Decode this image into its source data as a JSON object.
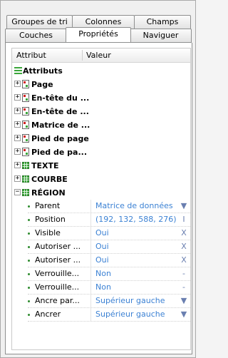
{
  "tabs_row1": [
    {
      "label": "Groupes de tri"
    },
    {
      "label": "Colonnes"
    },
    {
      "label": "Champs"
    }
  ],
  "tabs_row2": [
    {
      "label": "Couches"
    },
    {
      "label": "Propriétés"
    },
    {
      "label": "Naviguer"
    }
  ],
  "tree": {
    "col_attribut": "Attribut",
    "col_valeur": "Valeur",
    "root_label": "Attributs",
    "nodes": [
      {
        "label": "Page",
        "expander": "+"
      },
      {
        "label": "En-tête du ...",
        "expander": "+"
      },
      {
        "label": "En-tête de ...",
        "expander": "+"
      },
      {
        "label": "Matrice de ...",
        "expander": "+"
      },
      {
        "label": "Pied de page",
        "expander": "+"
      },
      {
        "label": "Pied de pa...",
        "expander": "+"
      },
      {
        "label": "TEXTE",
        "expander": "+"
      },
      {
        "label": "COURBE",
        "expander": "+"
      },
      {
        "label": "RÉGION",
        "expander": "−"
      }
    ],
    "properties": [
      {
        "name": "Parent",
        "value": "Matrice de données",
        "control": "▼"
      },
      {
        "name": "Position",
        "value": "(192, 132, 588, 276)",
        "control": "I"
      },
      {
        "name": "Visible",
        "value": "Oui",
        "control": "X"
      },
      {
        "name": "Autoriser ...",
        "value": "Oui",
        "control": "X"
      },
      {
        "name": "Autoriser ...",
        "value": "Oui",
        "control": "X"
      },
      {
        "name": "Verrouille...",
        "value": "Non",
        "control": "-"
      },
      {
        "name": "Verrouille...",
        "value": "Non",
        "control": "-"
      },
      {
        "name": "Ancre par...",
        "value": "Supérieur gauche",
        "control": "▼"
      },
      {
        "name": "Ancrer",
        "value": "Supérieur gauche",
        "control": "▼"
      }
    ]
  },
  "colors": {
    "value_text": "#3c82d4",
    "property_bullet": "#2e8b2e",
    "red_icon": "#d02020",
    "green_icon": "#3aa63a"
  }
}
